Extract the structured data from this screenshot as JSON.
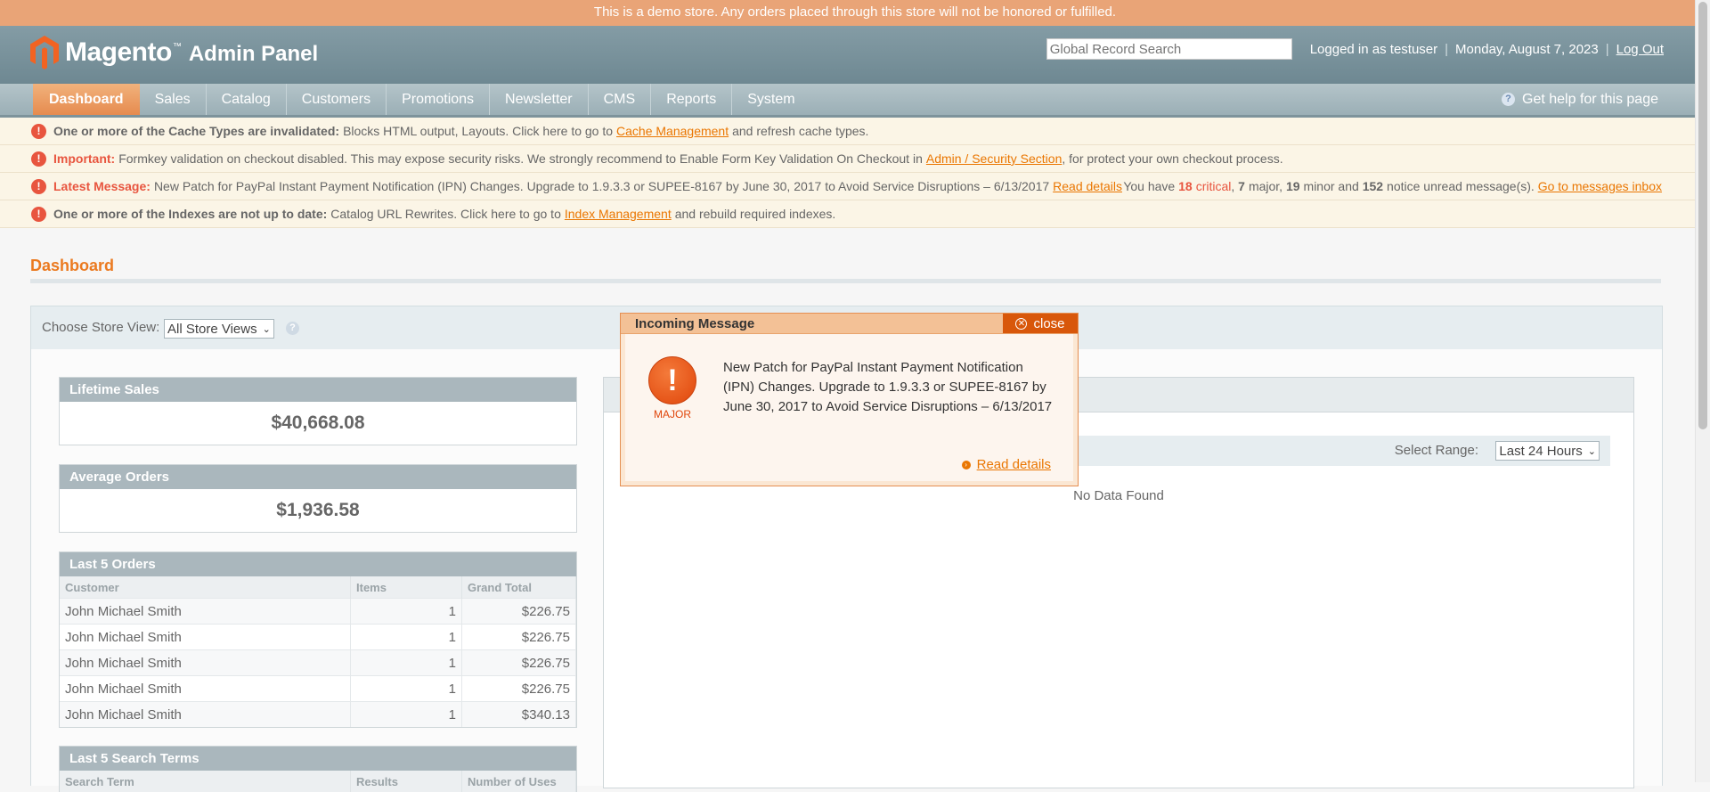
{
  "demo_notice": "This is a demo store. Any orders placed through this store will not be honored or fulfilled.",
  "header": {
    "logo_word": "Magento",
    "logo_tm": "™",
    "logo_panel": "Admin Panel",
    "search_placeholder": "Global Record Search",
    "logged_in": "Logged in as testuser",
    "date": "Monday, August 7, 2023",
    "logout": "Log Out",
    "separator": "|"
  },
  "nav": {
    "items": [
      "Dashboard",
      "Sales",
      "Catalog",
      "Customers",
      "Promotions",
      "Newsletter",
      "CMS",
      "Reports",
      "System"
    ],
    "help": "Get help for this page"
  },
  "messages": {
    "cache": {
      "bold": "One or more of the Cache Types are invalidated:",
      "text_before": "Blocks HTML output, Layouts. Click here to go to",
      "link": "Cache Management",
      "text_after": "and refresh cache types."
    },
    "important": {
      "bold": "Important:",
      "text_before": "Formkey validation on checkout disabled. This may expose security risks. We strongly recommend to Enable Form Key Validation On Checkout in",
      "link": "Admin / Security Section",
      "text_after": ", for protect your own checkout process."
    },
    "latest": {
      "bold": "Latest Message:",
      "text": "New Patch for PayPal Instant Payment Notification (IPN) Changes. Upgrade to 1.9.3.3 or SUPEE-8167 by June 30, 2017 to Avoid Service Disruptions – 6/13/2017",
      "link": "Read details",
      "inbox_prefix": "You have",
      "critical_count": "18",
      "critical_label": "critical",
      "major_count": "7",
      "major_label": "major,",
      "minor_count": "19",
      "minor_label": "minor and",
      "notice_count": "152",
      "notice_label": "notice unread message(s).",
      "inbox_link": "Go to messages inbox"
    },
    "indexes": {
      "bold": "One or more of the Indexes are not up to date:",
      "text_before": "Catalog URL Rewrites. Click here to go to",
      "link": "Index Management",
      "text_after": "and rebuild required indexes."
    }
  },
  "page_title": "Dashboard",
  "store_view": {
    "label": "Choose Store View:",
    "selected": "All Store Views",
    "help": "?"
  },
  "lifetime_sales": {
    "title": "Lifetime Sales",
    "value": "$40,668.08"
  },
  "average_orders": {
    "title": "Average Orders",
    "value": "$1,936.58"
  },
  "last_orders": {
    "title": "Last 5 Orders",
    "columns": [
      "Customer",
      "Items",
      "Grand Total"
    ],
    "rows": [
      [
        "John Michael Smith",
        "1",
        "$226.75"
      ],
      [
        "John Michael Smith",
        "1",
        "$226.75"
      ],
      [
        "John Michael Smith",
        "1",
        "$226.75"
      ],
      [
        "John Michael Smith",
        "1",
        "$226.75"
      ],
      [
        "John Michael Smith",
        "1",
        "$340.13"
      ]
    ]
  },
  "last_search_terms": {
    "title": "Last 5 Search Terms",
    "columns": [
      "Search Term",
      "Results",
      "Number of Uses"
    ]
  },
  "chart_panel": {
    "range_label": "Select Range:",
    "range_selected": "Last 24 Hours",
    "no_data": "No Data Found"
  },
  "popup": {
    "title": "Incoming Message",
    "close": "close",
    "severity": "MAJOR",
    "text": "New Patch for PayPal Instant Payment Notification (IPN) Changes. Upgrade to 1.9.3.3 or SUPEE-8167 by June 30, 2017 to Avoid Service Disruptions – 6/13/2017",
    "read_details": "Read details"
  },
  "colors": {
    "accent": "#eb7a20",
    "demo_bar": "#e9a477",
    "header": "#6e8892",
    "error": "#e8553f"
  }
}
